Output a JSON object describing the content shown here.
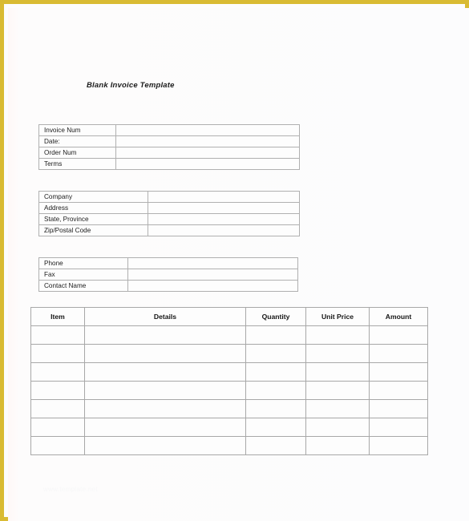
{
  "document": {
    "title": "Blank Invoice Template",
    "watermark": "www.template.net",
    "accent_border_color": "#d9bb33",
    "page_background_color": "#fdfdfd",
    "grid_line_color": "#a8a8a8",
    "text_color": "#1b1b1b"
  },
  "invoice_meta": {
    "fields": [
      {
        "label": "Invoice Num",
        "value": ""
      },
      {
        "label": "Date:",
        "value": ""
      },
      {
        "label": "Order Num",
        "value": ""
      },
      {
        "label": "Terms",
        "value": ""
      }
    ]
  },
  "company": {
    "fields": [
      {
        "label": "Company",
        "value": ""
      },
      {
        "label": "Address",
        "value": ""
      },
      {
        "label": "State, Province",
        "value": ""
      },
      {
        "label": "Zip/Postal Code",
        "value": ""
      }
    ]
  },
  "contact": {
    "fields": [
      {
        "label": "Phone",
        "value": ""
      },
      {
        "label": "Fax",
        "value": ""
      },
      {
        "label": "Contact Name",
        "value": ""
      }
    ]
  },
  "line_items": {
    "columns": [
      "Item",
      "Details",
      "Quantity",
      "Unit Price",
      "Amount"
    ],
    "rows": [
      {
        "item": "",
        "details": "",
        "quantity": "",
        "unit_price": "",
        "amount": ""
      },
      {
        "item": "",
        "details": "",
        "quantity": "",
        "unit_price": "",
        "amount": ""
      },
      {
        "item": "",
        "details": "",
        "quantity": "",
        "unit_price": "",
        "amount": ""
      },
      {
        "item": "",
        "details": "",
        "quantity": "",
        "unit_price": "",
        "amount": ""
      },
      {
        "item": "",
        "details": "",
        "quantity": "",
        "unit_price": "",
        "amount": ""
      },
      {
        "item": "",
        "details": "",
        "quantity": "",
        "unit_price": "",
        "amount": ""
      },
      {
        "item": "",
        "details": "",
        "quantity": "",
        "unit_price": "",
        "amount": ""
      }
    ]
  }
}
